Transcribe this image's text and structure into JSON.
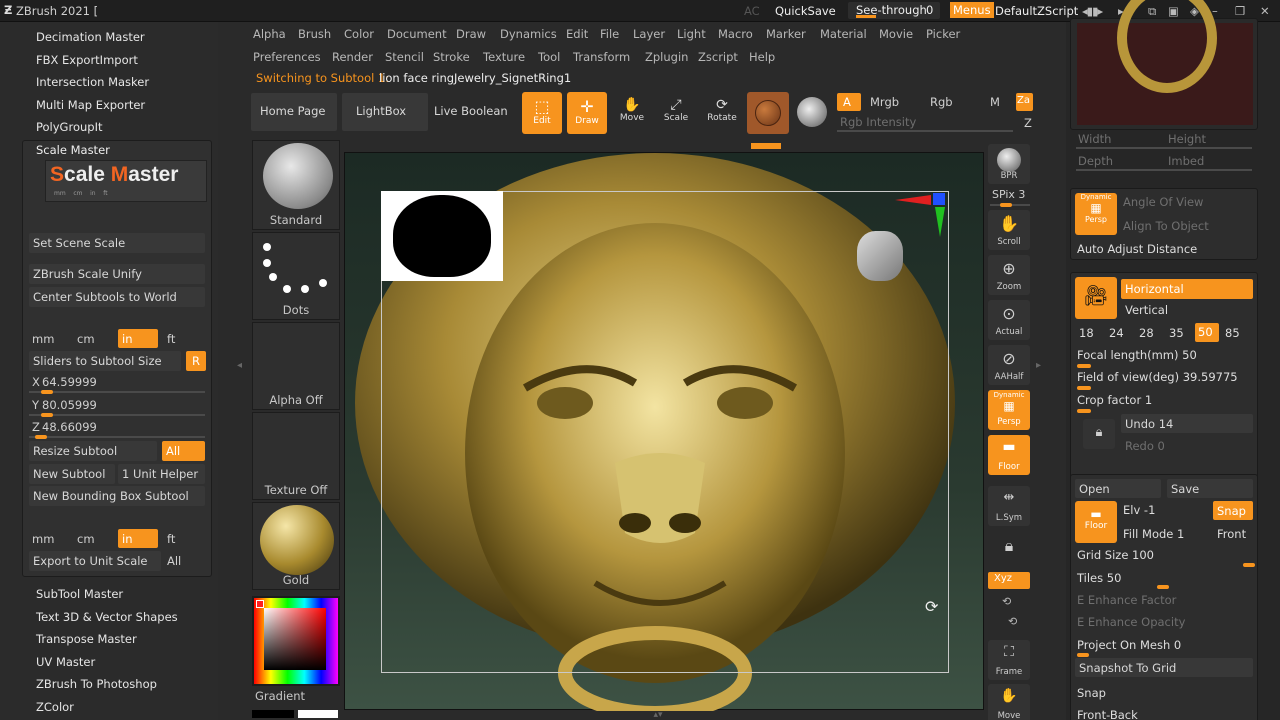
{
  "app": {
    "title": "ZBrush 2021 [",
    "ac": "AC",
    "quicksave": "QuickSave",
    "see_through_label": "See-through",
    "see_through_value": "0",
    "menus": "Menus",
    "default_script": "DefaultZScript"
  },
  "menubar": {
    "row1": [
      "Alpha",
      "Brush",
      "Color",
      "Document",
      "Draw",
      "Dynamics",
      "Edit",
      "File",
      "Layer",
      "Light",
      "Macro",
      "Marker",
      "Material",
      "Movie",
      "Picker"
    ],
    "row2": [
      "Preferences",
      "Render",
      "Stencil",
      "Stroke",
      "Texture",
      "Tool",
      "Transform",
      "Zplugin",
      "Zscript",
      "Help"
    ]
  },
  "status": {
    "prefix": "Switching to Subtool 1:",
    "text": "lion face ringJewelry_SignetRing1"
  },
  "toolbar": {
    "home_page": "Home Page",
    "lightbox": "LightBox",
    "live_boolean": "Live Boolean",
    "edit": "Edit",
    "draw": "Draw",
    "move": "Move",
    "scale": "Scale",
    "rotate": "Rotate",
    "a": "A",
    "mrgb": "Mrgb",
    "rgb": "Rgb",
    "m": "M",
    "za": "Za",
    "rgb_intensity": "Rgb Intensity",
    "z": "Z"
  },
  "left_panel": {
    "top_items": [
      "Decimation Master",
      "FBX ExportImport",
      "Intersection Masker",
      "Multi Map Exporter",
      "PolyGroupIt"
    ],
    "scale_master": {
      "header": "Scale Master",
      "logo_s": "S",
      "logo_cale": "cale ",
      "logo_m": "M",
      "logo_aster": "aster",
      "ruler": "mm    cm    in    ft",
      "set_scene_scale": "Set Scene Scale",
      "unify": "ZBrush Scale Unify",
      "center": "Center Subtools to World",
      "units": [
        "mm",
        "cm",
        "in",
        "ft"
      ],
      "sliders": "Sliders to Subtool Size",
      "r": "R",
      "x_label": "X",
      "x_value": "64.59999",
      "y_label": "Y",
      "y_value": "80.05999",
      "z_label": "Z",
      "z_value": "48.66099",
      "resize": "Resize Subtool",
      "all": "All",
      "new_subtool": "New Subtool",
      "unit_helper": "1 Unit Helper",
      "new_bbox": "New Bounding Box Subtool",
      "units2": [
        "mm",
        "cm",
        "in",
        "ft"
      ],
      "export": "Export to Unit Scale",
      "all2": "All"
    },
    "bottom_items": [
      "SubTool Master",
      "Text 3D & Vector Shapes",
      "Transpose Master",
      "UV Master",
      "ZBrush To Photoshop",
      "ZColor"
    ]
  },
  "brush_column": {
    "standard": "Standard",
    "dots": "Dots",
    "alpha_off": "Alpha Off",
    "texture_off": "Texture Off",
    "gold": "Gold",
    "gradient": "Gradient"
  },
  "shelf": {
    "bpr": "BPR",
    "spix": "SPix 3",
    "scroll": "Scroll",
    "zoom": "Zoom",
    "actual": "Actual",
    "aahalf": "AAHalf",
    "dynamic": "Dynamic",
    "persp": "Persp",
    "floor": "Floor",
    "lsym": "L.Sym",
    "xyz": "Xyz",
    "frame": "Frame",
    "move": "Move"
  },
  "right_panel": {
    "width": "Width",
    "height": "Height",
    "depth": "Depth",
    "imbed": "Imbed",
    "dynamic": "Dynamic",
    "persp": "Persp",
    "angle_of_view": "Angle Of View",
    "align_to_object": "Align To Object",
    "auto_adjust": "Auto Adjust Distance",
    "horizontal": "Horizontal",
    "vertical": "Vertical",
    "focal_values": [
      "18",
      "24",
      "28",
      "35",
      "50",
      "85"
    ],
    "focal_selected": "50",
    "focal_length": "Focal length(mm) 50",
    "fov": "Field of view(deg) 39.59775",
    "crop": "Crop factor 1",
    "undo": "Undo 14",
    "redo": "Redo 0",
    "open": "Open",
    "save": "Save",
    "floor": "Floor",
    "elv": "Elv -1",
    "snap": "Snap",
    "fill_mode": "Fill Mode 1",
    "front": "Front",
    "grid_size": "Grid Size 100",
    "tiles": "Tiles 50",
    "e_factor": "E Enhance Factor",
    "e_opacity": "E Enhance Opacity",
    "project_mesh": "Project On Mesh 0",
    "snapshot": "Snapshot To Grid",
    "snap2": "Snap",
    "front_back": "Front-Back"
  },
  "colors": {
    "accent": "#f7941e",
    "gold": "#b8963a"
  }
}
